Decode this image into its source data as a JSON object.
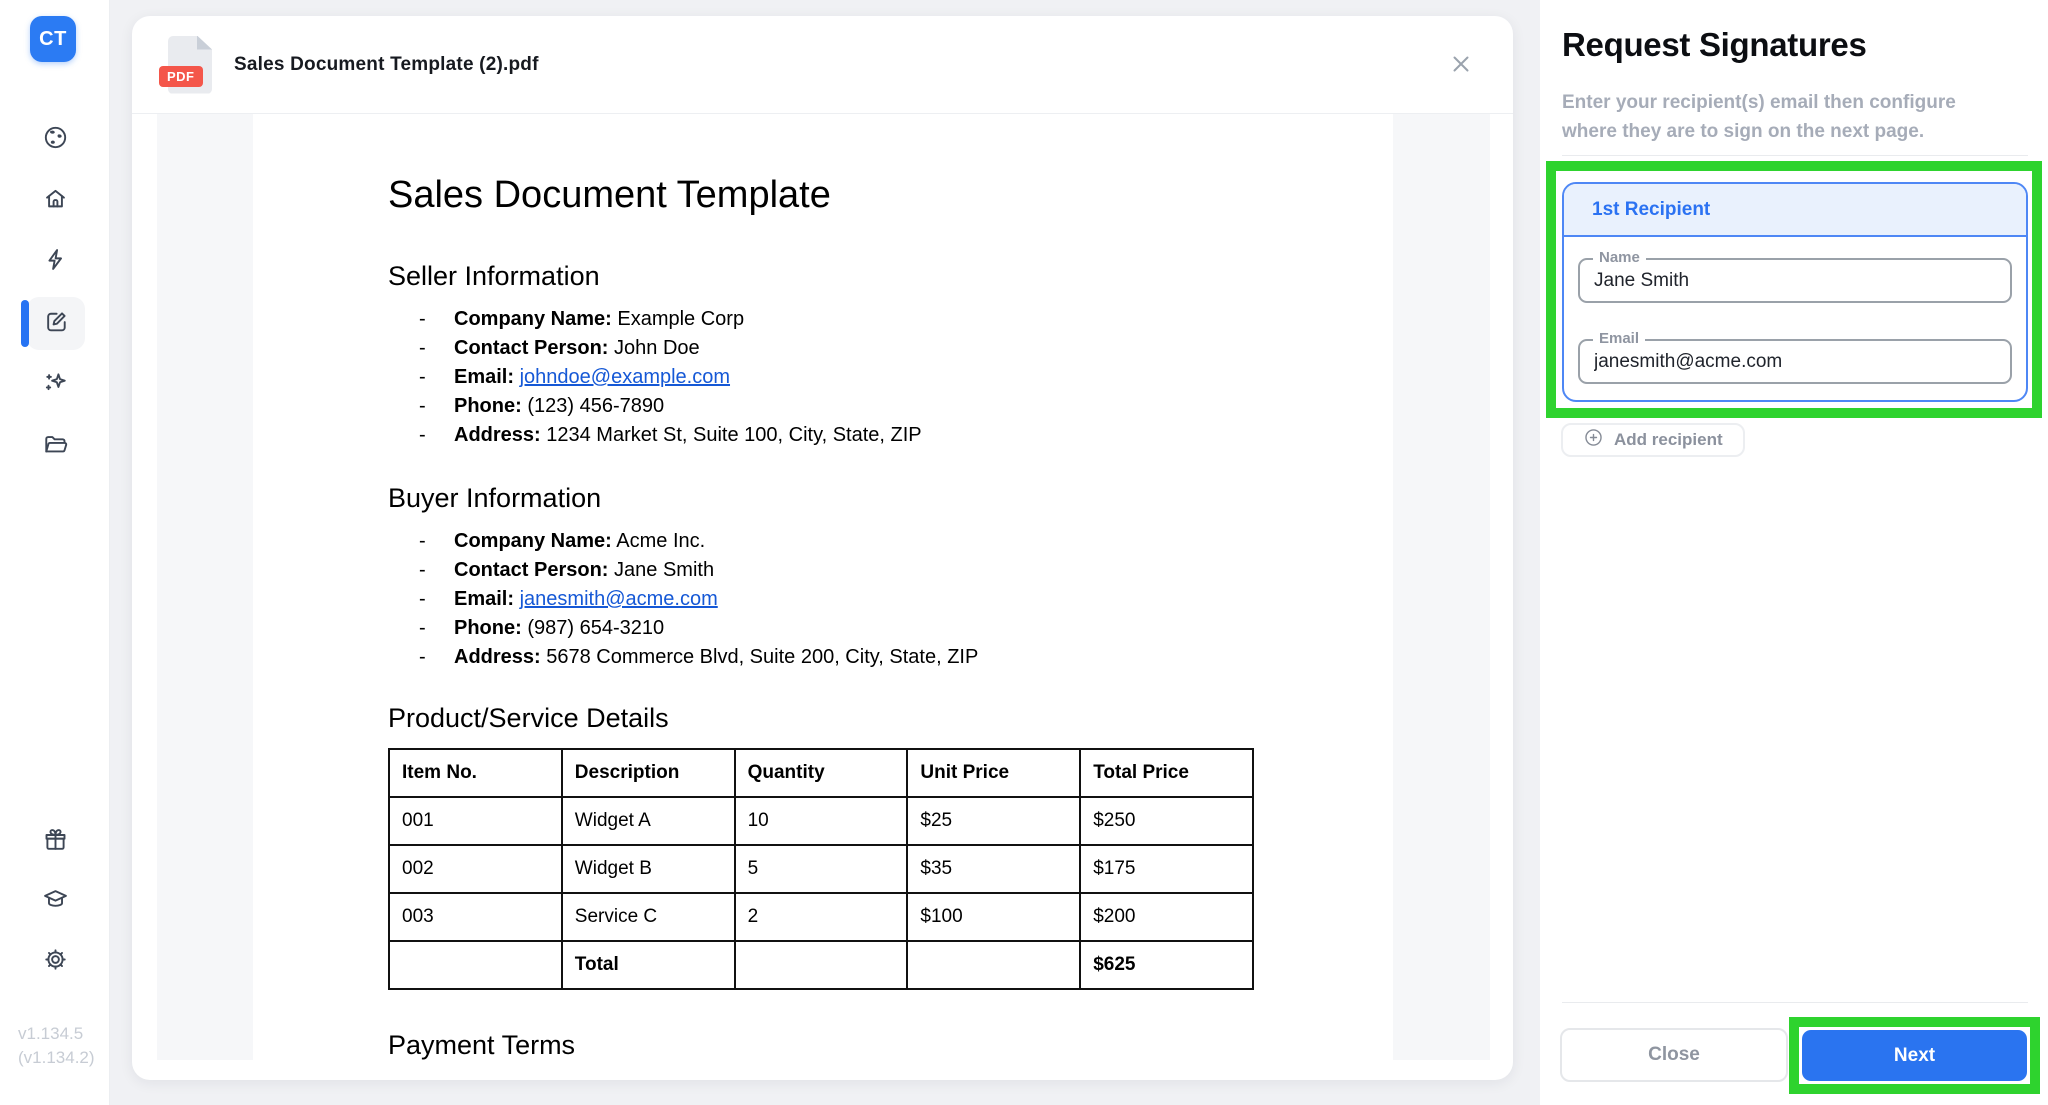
{
  "colors": {
    "accent_blue": "#2673f3",
    "annotation_green": "#2ed32e",
    "pdf_red": "#f4564a",
    "link_blue": "#1558d6"
  },
  "sidebar": {
    "logo": "CT",
    "items": [
      {
        "name": "globe"
      },
      {
        "name": "home"
      },
      {
        "name": "lightning"
      },
      {
        "name": "edit",
        "active": true
      },
      {
        "name": "sparkles"
      },
      {
        "name": "folder"
      }
    ],
    "bottom_items": [
      {
        "name": "gift"
      },
      {
        "name": "graduation-cap"
      },
      {
        "name": "settings"
      }
    ],
    "version_line1": "v1.134.5",
    "version_line2": "(v1.134.2)"
  },
  "modal": {
    "filename": "Sales Document Template (2).pdf",
    "pdf_badge": "PDF"
  },
  "doc": {
    "title": "Sales Document Template",
    "bullet": "-",
    "h_seller": "Seller Information",
    "h_buyer": "Buyer Information",
    "h_product": "Product/Service Details",
    "h_payment": "Payment Terms",
    "seller_items": [
      {
        "label": "Company Name:",
        "value": " Example Corp"
      },
      {
        "label": "Contact Person:",
        "value": " John Doe"
      },
      {
        "label": "Email:",
        "value": " ",
        "link": "johndoe@example.com"
      },
      {
        "label": "Phone:",
        "value": " (123) 456-7890"
      },
      {
        "label": "Address:",
        "value": " 1234 Market St, Suite 100, City, State, ZIP"
      }
    ],
    "buyer_items": [
      {
        "label": "Company Name:",
        "value": " Acme Inc."
      },
      {
        "label": "Contact Person:",
        "value": " Jane Smith"
      },
      {
        "label": "Email:",
        "value": " ",
        "link": "janesmith@acme.com"
      },
      {
        "label": "Phone:",
        "value": " (987) 654-3210"
      },
      {
        "label": "Address:",
        "value": " 5678 Commerce Blvd, Suite 200, City, State, ZIP"
      }
    ],
    "table": {
      "headers": [
        "Item No.",
        "Description",
        "Quantity",
        "Unit Price",
        "Total Price"
      ],
      "rows": [
        [
          "001",
          "Widget A",
          "10",
          "$25",
          "$250"
        ],
        [
          "002",
          "Widget B",
          "5",
          "$35",
          "$175"
        ],
        [
          "003",
          "Service C",
          "2",
          "$100",
          "$200"
        ],
        [
          "",
          "Total",
          "",
          "",
          "$625"
        ]
      ]
    }
  },
  "panel": {
    "title": "Request Signatures",
    "subtitle_line1": "Enter your recipient(s) email then configure",
    "subtitle_line2": "where they are to sign on the next page.",
    "card": {
      "header": "1st Recipient",
      "name_label": "Name",
      "name_value": "Jane Smith",
      "email_label": "Email",
      "email_value": "janesmith@acme.com"
    },
    "add_recipient": "Add recipient",
    "close": "Close",
    "next": "Next"
  }
}
